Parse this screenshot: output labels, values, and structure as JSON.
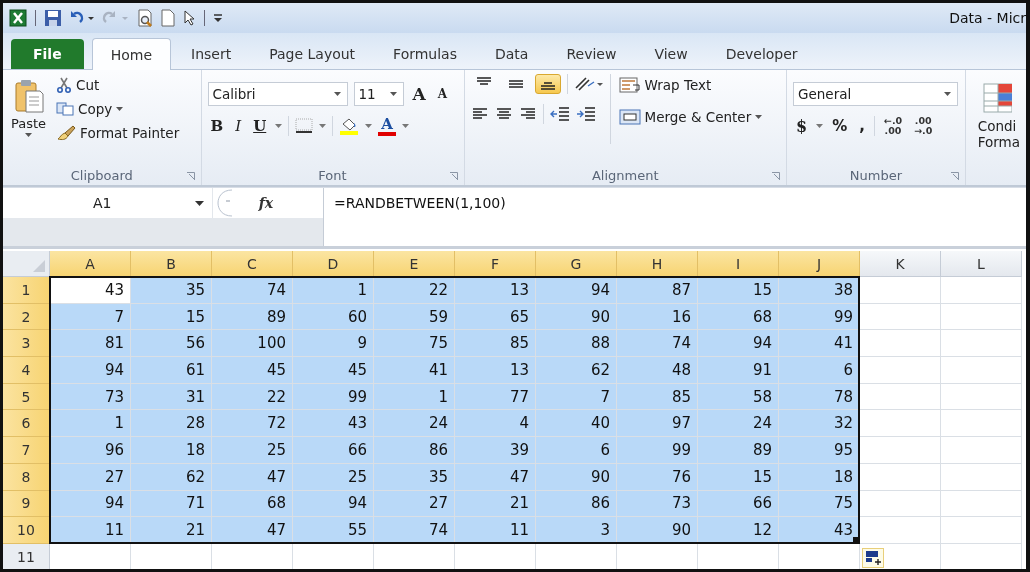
{
  "window": {
    "title": "Data - Micr"
  },
  "tabs": [
    {
      "label": "File",
      "kind": "file",
      "selected": false
    },
    {
      "label": "Home",
      "kind": "tab",
      "selected": true
    },
    {
      "label": "Insert",
      "kind": "tab",
      "selected": false
    },
    {
      "label": "Page Layout",
      "kind": "tab",
      "selected": false
    },
    {
      "label": "Formulas",
      "kind": "tab",
      "selected": false
    },
    {
      "label": "Data",
      "kind": "tab",
      "selected": false
    },
    {
      "label": "Review",
      "kind": "tab",
      "selected": false
    },
    {
      "label": "View",
      "kind": "tab",
      "selected": false
    },
    {
      "label": "Developer",
      "kind": "tab",
      "selected": false
    }
  ],
  "ribbon": {
    "clipboard": {
      "label": "Clipboard",
      "paste": "Paste",
      "cut": "Cut",
      "copy": "Copy",
      "format_painter": "Format Painter"
    },
    "font": {
      "label": "Font",
      "font_name": "Calibri",
      "font_size": "11",
      "grow": "A",
      "shrink": "A",
      "bold": "B",
      "italic": "I",
      "underline": "U",
      "font_color": "A"
    },
    "alignment": {
      "label": "Alignment",
      "vertical": [
        {
          "kind": "top",
          "selected": false
        },
        {
          "kind": "middle",
          "selected": false
        },
        {
          "kind": "bottom",
          "selected": true
        }
      ],
      "wrap_text": "Wrap Text",
      "merge_center": "Merge & Center"
    },
    "number": {
      "label": "Number",
      "format": "General",
      "currency": "$",
      "percent": "%",
      "comma": ",",
      "increase_decimal": [
        "←.0",
        ".00"
      ],
      "decrease_decimal": [
        ".00",
        "→.0"
      ]
    },
    "styles": {
      "conditional_formatting": [
        "Condi",
        "Forma"
      ]
    }
  },
  "formula_bar": {
    "name_box": "A1",
    "function_label": "fx",
    "formula": "=RANDBETWEEN(1,100)"
  },
  "grid": {
    "columns": [
      {
        "label": "A",
        "selected": true
      },
      {
        "label": "B",
        "selected": true
      },
      {
        "label": "C",
        "selected": true
      },
      {
        "label": "D",
        "selected": true
      },
      {
        "label": "E",
        "selected": true
      },
      {
        "label": "F",
        "selected": true
      },
      {
        "label": "G",
        "selected": true
      },
      {
        "label": "H",
        "selected": true
      },
      {
        "label": "I",
        "selected": true
      },
      {
        "label": "J",
        "selected": true
      },
      {
        "label": "K",
        "selected": false
      },
      {
        "label": "L",
        "selected": false
      }
    ],
    "rows": [
      {
        "label": "1",
        "selected": true,
        "cells": [
          {
            "text": "43",
            "active": true
          },
          {
            "text": "35",
            "active": false
          },
          {
            "text": "74",
            "active": false
          },
          {
            "text": "1",
            "active": false
          },
          {
            "text": "22",
            "active": false
          },
          {
            "text": "13",
            "active": false
          },
          {
            "text": "94",
            "active": false
          },
          {
            "text": "87",
            "active": false
          },
          {
            "text": "15",
            "active": false
          },
          {
            "text": "38",
            "active": false
          }
        ]
      },
      {
        "label": "2",
        "selected": true,
        "cells": [
          "7",
          "15",
          "89",
          "60",
          "59",
          "65",
          "90",
          "16",
          "68",
          "99"
        ]
      },
      {
        "label": "3",
        "selected": true,
        "cells": [
          "81",
          "56",
          "100",
          "9",
          "75",
          "85",
          "88",
          "74",
          "94",
          "41"
        ]
      },
      {
        "label": "4",
        "selected": true,
        "cells": [
          "94",
          "61",
          "45",
          "45",
          "41",
          "13",
          "62",
          "48",
          "91",
          "6"
        ]
      },
      {
        "label": "5",
        "selected": true,
        "cells": [
          "73",
          "31",
          "22",
          "99",
          "1",
          "77",
          "7",
          "85",
          "58",
          "78"
        ]
      },
      {
        "label": "6",
        "selected": true,
        "cells": [
          "1",
          "28",
          "72",
          "43",
          "24",
          "4",
          "40",
          "97",
          "24",
          "32"
        ]
      },
      {
        "label": "7",
        "selected": true,
        "cells": [
          "96",
          "18",
          "25",
          "66",
          "86",
          "39",
          "6",
          "99",
          "89",
          "95"
        ]
      },
      {
        "label": "8",
        "selected": true,
        "cells": [
          "27",
          "62",
          "47",
          "25",
          "35",
          "47",
          "90",
          "76",
          "15",
          "18"
        ]
      },
      {
        "label": "9",
        "selected": true,
        "cells": [
          "94",
          "71",
          "68",
          "94",
          "27",
          "21",
          "86",
          "73",
          "66",
          "75"
        ]
      },
      {
        "label": "10",
        "selected": true,
        "cells": [
          "11",
          "21",
          "47",
          "55",
          "74",
          "11",
          "3",
          "90",
          "12",
          "43"
        ]
      },
      {
        "label": "11",
        "selected": false
      }
    ]
  }
}
